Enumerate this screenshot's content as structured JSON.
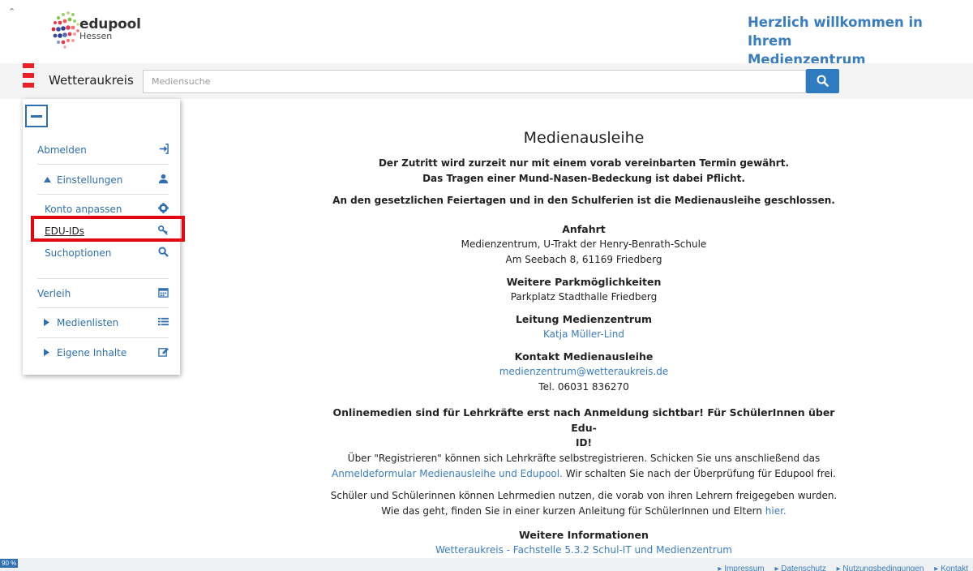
{
  "header": {
    "logo_name": "edupool",
    "logo_sub": "Hessen",
    "welcome_line1": "Herzlich willkommen in Ihrem",
    "welcome_line2": "Medienzentrum Wetteraukreis"
  },
  "search": {
    "region": "Wetteraukreis",
    "placeholder": "Mediensuche"
  },
  "menu": {
    "items": [
      {
        "label": "Abmelden",
        "icon": "sign-in-icon"
      },
      {
        "label": "Einstellungen",
        "icon": "user-icon"
      },
      {
        "label": "Konto anpassen",
        "icon": "gear-icon"
      },
      {
        "label": "EDU-IDs",
        "icon": "key-icon"
      },
      {
        "label": "Suchoptionen",
        "icon": "search-icon"
      },
      {
        "label": "Verleih",
        "icon": "calendar-icon"
      },
      {
        "label": "Medienlisten",
        "icon": "list-icon"
      },
      {
        "label": "Eigene Inhalte",
        "icon": "edit-icon"
      }
    ]
  },
  "content": {
    "title": "Medienausleihe",
    "notice1": "Der Zutritt wird zurzeit nur mit einem vorab vereinbarten Termin gewährt.",
    "notice2": "Das Tragen einer Mund-Nasen-Bedeckung ist dabei Pflicht.",
    "notice3": "An den gesetzlichen Feiertagen und in den Schulferien ist die Medienausleihe geschlossen.",
    "anfahrt_h": "Anfahrt",
    "anfahrt_1": "Medienzentrum, U-Trakt der Henry-Benrath-Schule",
    "anfahrt_2": "Am Seebach 8, 61169 Friedberg",
    "park_h": "Weitere Parkmöglichkeiten",
    "park_1": "Parkplatz Stadthalle Friedberg",
    "leitung_h": "Leitung Medienzentrum",
    "leitung_name": "Katja Müller-Lind",
    "kontakt_h": "Kontakt Medienausleihe",
    "kontakt_email": "medienzentrum@wetteraukreis.de",
    "kontakt_tel": "Tel. 06031 836270",
    "online_h1": "Onlinemedien sind für Lehrkräfte erst nach Anmeldung sichtbar! Für SchülerInnen über Edu-",
    "online_h2": "ID!",
    "reg_1": "Über \"Registrieren\" können sich Lehrkräfte selbstregistrieren. Schicken Sie uns anschließend das",
    "reg_link": "Anmeldeformular Medienausleihe und Edupool.",
    "reg_2": " Wir schalten Sie nach der Überprüfung für Edupool frei.",
    "schueler_1": "Schüler und Schülerinnen können Lehrmedien nutzen, die vorab von ihren Lehrern freigegeben wurden.",
    "schueler_2": "Wie das geht, finden Sie in einer kurzen Anleitung für SchülerInnen und Eltern ",
    "schueler_link": "hier.",
    "info_h": "Weitere Informationen",
    "info_link": "Wetteraukreis - Fachstelle 5.3.2 Schul-IT und Medienzentrum"
  },
  "footer": {
    "zoom": "90 %",
    "links": [
      "▸ Impressum",
      "▸ Datenschutz",
      "▸ Nutzungsbedingungen",
      "▸ Kontakt"
    ]
  },
  "colors": {
    "accent": "#2f7bc0",
    "link": "#3a7dbf",
    "highlight": "#e30613",
    "flag": "#e8202a"
  }
}
